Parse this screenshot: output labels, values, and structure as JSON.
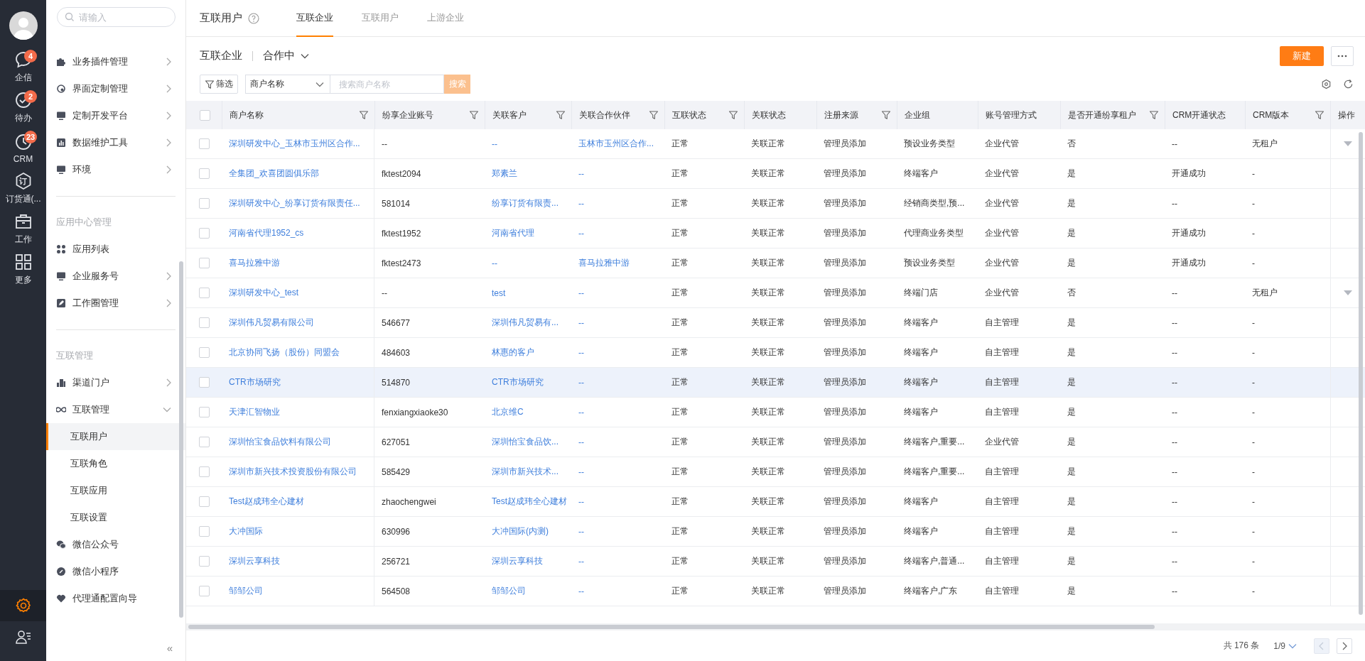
{
  "rail": {
    "items": [
      {
        "label": "企信",
        "kind": "chat",
        "badge": "4",
        "selected": false
      },
      {
        "label": "待办",
        "kind": "check",
        "badge": "2",
        "selected": false
      },
      {
        "label": "CRM",
        "kind": "clock",
        "badge": "23",
        "selected": false
      },
      {
        "label": "订货通(...",
        "kind": "hexagon",
        "glyph": "订",
        "selected": false
      },
      {
        "label": "工作",
        "kind": "briefcase",
        "selected": false
      },
      {
        "label": "更多",
        "kind": "grid",
        "selected": false
      }
    ],
    "bottom": [
      {
        "kind": "gear",
        "selected": true
      },
      {
        "kind": "contacts",
        "selected": false
      }
    ]
  },
  "sidebar": {
    "search": {
      "placeholder": "请输入"
    },
    "groups": [
      {
        "items": [
          {
            "label": "业务插件管理",
            "kind": "puzzle",
            "expanded": false
          },
          {
            "label": "界面定制管理",
            "kind": "palette",
            "expanded": false
          },
          {
            "label": "定制开发平台",
            "kind": "monitor",
            "expanded": false
          },
          {
            "label": "数据维护工具",
            "kind": "chart",
            "expanded": false
          },
          {
            "label": "环境",
            "kind": "monitor",
            "expanded": false
          }
        ]
      },
      {
        "title": "应用中心管理",
        "items": [
          {
            "label": "应用列表",
            "kind": "grid"
          },
          {
            "label": "企业服务号",
            "kind": "monitor",
            "expanded": false
          },
          {
            "label": "工作圈管理",
            "kind": "edit",
            "expanded": false
          }
        ]
      },
      {
        "title": "互联管理",
        "items": [
          {
            "label": "渠道门户",
            "kind": "building",
            "expanded": false
          },
          {
            "label": "互联管理",
            "kind": "infinity",
            "expanded": true,
            "children": [
              {
                "label": "互联用户",
                "selected": true
              },
              {
                "label": "互联角色",
                "selected": false
              },
              {
                "label": "互联应用",
                "selected": false
              },
              {
                "label": "互联设置",
                "selected": false
              }
            ]
          },
          {
            "label": "微信公众号",
            "kind": "chat"
          },
          {
            "label": "微信小程序",
            "kind": "link"
          },
          {
            "label": "代理通配置向导",
            "kind": "heart"
          }
        ]
      }
    ],
    "collapse": "«"
  },
  "page": {
    "title": "互联用户",
    "tabs": [
      {
        "label": "互联企业",
        "selected": true
      },
      {
        "label": "互联用户",
        "selected": false
      },
      {
        "label": "上游企业",
        "selected": false
      }
    ]
  },
  "view": {
    "title": "互联企业",
    "status_filter": "合作中",
    "new_button": "新建"
  },
  "filters": {
    "filter_button": "筛选",
    "field_select": "商户名称",
    "search": {
      "placeholder": "搜索商户名称"
    },
    "search_button": "搜索"
  },
  "table": {
    "all_checked": false,
    "columns": [
      {
        "label": "商户名称",
        "kind": "link",
        "filterable": true
      },
      {
        "label": "纷享企业账号",
        "kind": "text",
        "filterable": true
      },
      {
        "label": "关联客户",
        "kind": "link",
        "filterable": true
      },
      {
        "label": "关联合作伙伴",
        "kind": "link",
        "filterable": true
      },
      {
        "label": "互联状态",
        "kind": "text",
        "filterable": true
      },
      {
        "label": "关联状态",
        "kind": "text",
        "filterable": false
      },
      {
        "label": "注册来源",
        "kind": "text",
        "filterable": true
      },
      {
        "label": "企业组",
        "kind": "text",
        "filterable": false
      },
      {
        "label": "账号管理方式",
        "kind": "text",
        "filterable": false
      },
      {
        "label": "是否开通纷享租户",
        "kind": "text",
        "filterable": true
      },
      {
        "label": "CRM开通状态",
        "kind": "text",
        "filterable": false
      },
      {
        "label": "CRM版本",
        "kind": "text",
        "filterable": true
      },
      {
        "label": "操作",
        "kind": "action",
        "filterable": false
      }
    ],
    "rows": [
      {
        "checked": false,
        "highlighted": false,
        "menu": true,
        "cells": [
          "深圳研发中心_玉林市玉州区合作...",
          "--",
          "--",
          "玉林市玉州区合作...",
          "正常",
          "关联正常",
          "管理员添加",
          "预设业务类型",
          "企业代管",
          "否",
          "--",
          "无租户"
        ]
      },
      {
        "checked": false,
        "highlighted": false,
        "menu": false,
        "cells": [
          "全集团_欢喜团圆俱乐部",
          "fktest2094",
          "郑素兰",
          "--",
          "正常",
          "关联正常",
          "管理员添加",
          "终端客户",
          "企业代管",
          "是",
          "开通成功",
          "-"
        ]
      },
      {
        "checked": false,
        "highlighted": false,
        "menu": false,
        "cells": [
          "深圳研发中心_纷享订货有限责任...",
          "581014",
          "纷享订货有限责...",
          "--",
          "正常",
          "关联正常",
          "管理员添加",
          "经销商类型,预...",
          "企业代管",
          "是",
          "--",
          "-"
        ]
      },
      {
        "checked": false,
        "highlighted": false,
        "menu": false,
        "cells": [
          "河南省代理1952_cs",
          "fktest1952",
          "河南省代理",
          "--",
          "正常",
          "关联正常",
          "管理员添加",
          "代理商业务类型",
          "企业代管",
          "是",
          "开通成功",
          "-"
        ]
      },
      {
        "checked": false,
        "highlighted": false,
        "menu": false,
        "cells": [
          "喜马拉雅中游",
          "fktest2473",
          "--",
          "喜马拉雅中游",
          "正常",
          "关联正常",
          "管理员添加",
          "预设业务类型",
          "企业代管",
          "是",
          "开通成功",
          "-"
        ]
      },
      {
        "checked": false,
        "highlighted": false,
        "menu": true,
        "cells": [
          "深圳研发中心_test",
          "--",
          "test",
          "--",
          "正常",
          "关联正常",
          "管理员添加",
          "终端门店",
          "企业代管",
          "否",
          "--",
          "无租户"
        ]
      },
      {
        "checked": false,
        "highlighted": false,
        "menu": false,
        "cells": [
          "深圳伟凡贸易有限公司",
          "546677",
          "深圳伟凡贸易有...",
          "--",
          "正常",
          "关联正常",
          "管理员添加",
          "终端客户",
          "自主管理",
          "是",
          "--",
          "-"
        ]
      },
      {
        "checked": false,
        "highlighted": false,
        "menu": false,
        "cells": [
          "北京协同飞扬（股份）同盟会",
          "484603",
          "林惠的客户",
          "--",
          "正常",
          "关联正常",
          "管理员添加",
          "终端客户",
          "自主管理",
          "是",
          "--",
          "-"
        ]
      },
      {
        "checked": false,
        "highlighted": true,
        "menu": false,
        "cells": [
          "CTR市场研究",
          "514870",
          "CTR市场研究",
          "--",
          "正常",
          "关联正常",
          "管理员添加",
          "终端客户",
          "自主管理",
          "是",
          "--",
          "-"
        ]
      },
      {
        "checked": false,
        "highlighted": false,
        "menu": false,
        "cells": [
          "天津汇智物业",
          "fenxiangxiaoke30",
          "北京维C",
          "--",
          "正常",
          "关联正常",
          "管理员添加",
          "终端客户",
          "自主管理",
          "是",
          "--",
          "-"
        ]
      },
      {
        "checked": false,
        "highlighted": false,
        "menu": false,
        "cells": [
          "深圳怡宝食品饮料有限公司",
          "627051",
          "深圳怡宝食品饮...",
          "--",
          "正常",
          "关联正常",
          "管理员添加",
          "终端客户,重要...",
          "企业代管",
          "是",
          "--",
          "-"
        ]
      },
      {
        "checked": false,
        "highlighted": false,
        "menu": false,
        "cells": [
          "深圳市新兴技术投资股份有限公司",
          "585429",
          "深圳市新兴技术...",
          "--",
          "正常",
          "关联正常",
          "管理员添加",
          "终端客户,重要...",
          "自主管理",
          "是",
          "--",
          "-"
        ]
      },
      {
        "checked": false,
        "highlighted": false,
        "menu": false,
        "cells": [
          "Test赵成玮全心建材",
          "zhaochengwei",
          "Test赵成玮全心建材",
          "--",
          "正常",
          "关联正常",
          "管理员添加",
          "终端客户",
          "自主管理",
          "是",
          "--",
          "-"
        ]
      },
      {
        "checked": false,
        "highlighted": false,
        "menu": false,
        "cells": [
          "大冲国际",
          "630996",
          "大冲国际(内测)",
          "--",
          "正常",
          "关联正常",
          "管理员添加",
          "终端客户",
          "自主管理",
          "是",
          "--",
          "-"
        ]
      },
      {
        "checked": false,
        "highlighted": false,
        "menu": false,
        "cells": [
          "深圳云享科技",
          "256721",
          "深圳云享科技",
          "--",
          "正常",
          "关联正常",
          "管理员添加",
          "终端客户,普通...",
          "自主管理",
          "是",
          "--",
          "-"
        ]
      },
      {
        "checked": false,
        "highlighted": false,
        "menu": false,
        "cells": [
          "邹邹公司",
          "564508",
          "邹邹公司",
          "--",
          "正常",
          "关联正常",
          "管理员添加",
          "终端客户,广东",
          "自主管理",
          "是",
          "--",
          "-"
        ]
      }
    ]
  },
  "pager": {
    "total": "共 176 条",
    "page": "1/9",
    "prev_disabled": true,
    "next_disabled": false
  }
}
